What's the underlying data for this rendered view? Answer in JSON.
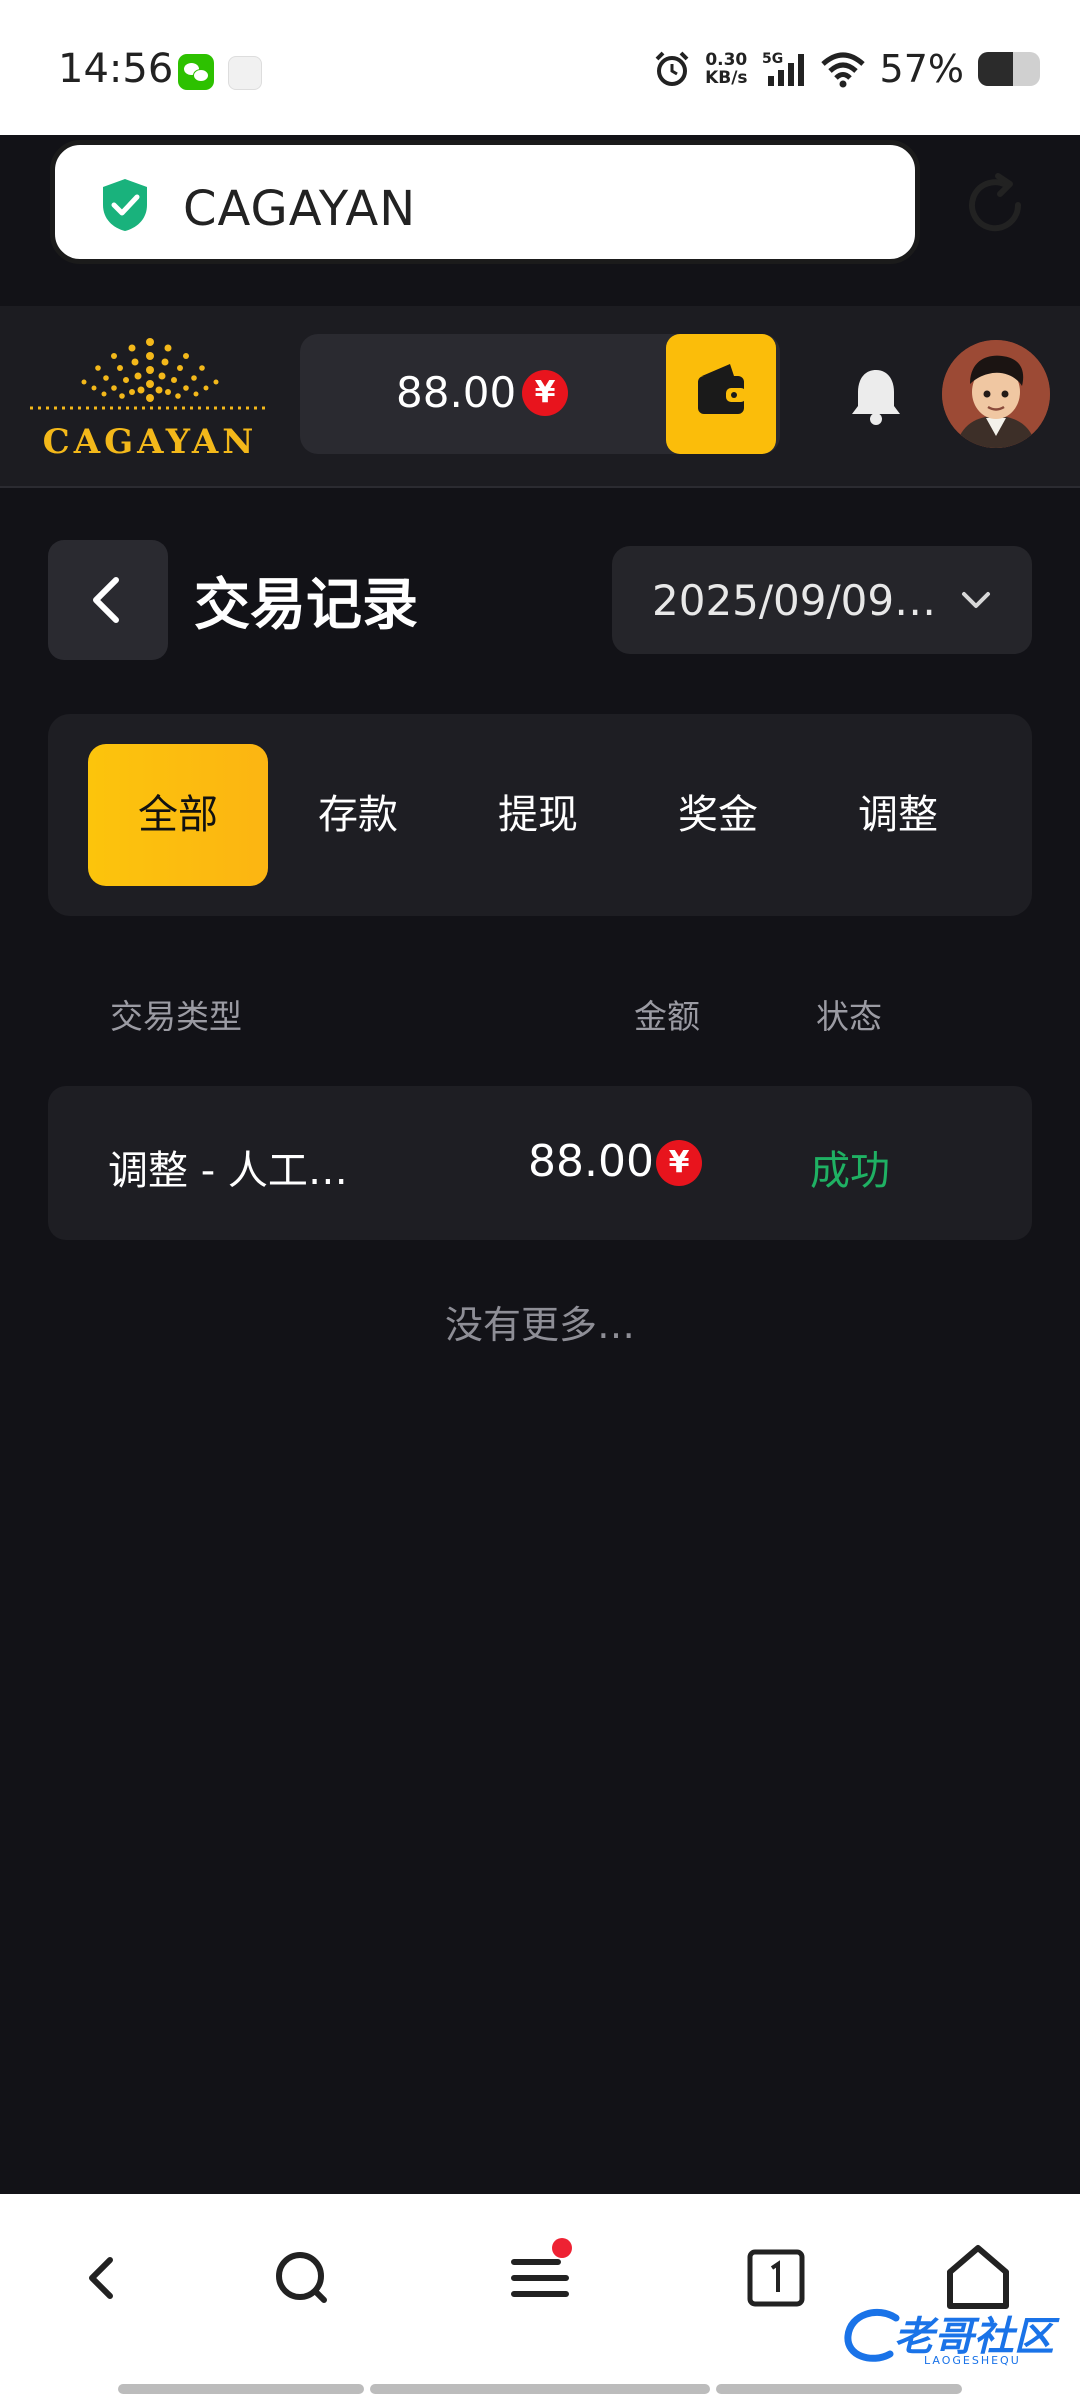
{
  "status_bar": {
    "time": "14:56",
    "net_speed_value": "0.30",
    "net_speed_unit": "KB/s",
    "network": "5G",
    "battery_percent_label": "57%",
    "battery_level": 0.57
  },
  "browser": {
    "url_text": "CAGAYAN",
    "security_icon": "shield-check-icon",
    "reload_icon": "reload-icon"
  },
  "site_header": {
    "logo_text": "CAGAYAN",
    "balance": "88.00",
    "currency_symbol": "¥",
    "wallet_icon": "wallet-icon",
    "bell_icon": "bell-icon"
  },
  "page": {
    "title": "交易记录",
    "date_filter": "2025/09/09…"
  },
  "tabs": [
    {
      "label": "全部",
      "active": true
    },
    {
      "label": "存款",
      "active": false
    },
    {
      "label": "提现",
      "active": false
    },
    {
      "label": "奖金",
      "active": false
    },
    {
      "label": "调整",
      "active": false
    }
  ],
  "table": {
    "headers": {
      "type": "交易类型",
      "amount": "金额",
      "status": "状态"
    },
    "rows": [
      {
        "type": "调整 - 人工…",
        "amount": "88.00",
        "currency": "¥",
        "status": "成功"
      }
    ],
    "end_message": "没有更多…"
  },
  "watermark": {
    "text": "老哥社区",
    "subtext": "LAOGESHEQU"
  },
  "colors": {
    "accent": "#fcc40c",
    "background": "#121217",
    "success": "#1fb163",
    "currency_badge": "#e8141d"
  }
}
